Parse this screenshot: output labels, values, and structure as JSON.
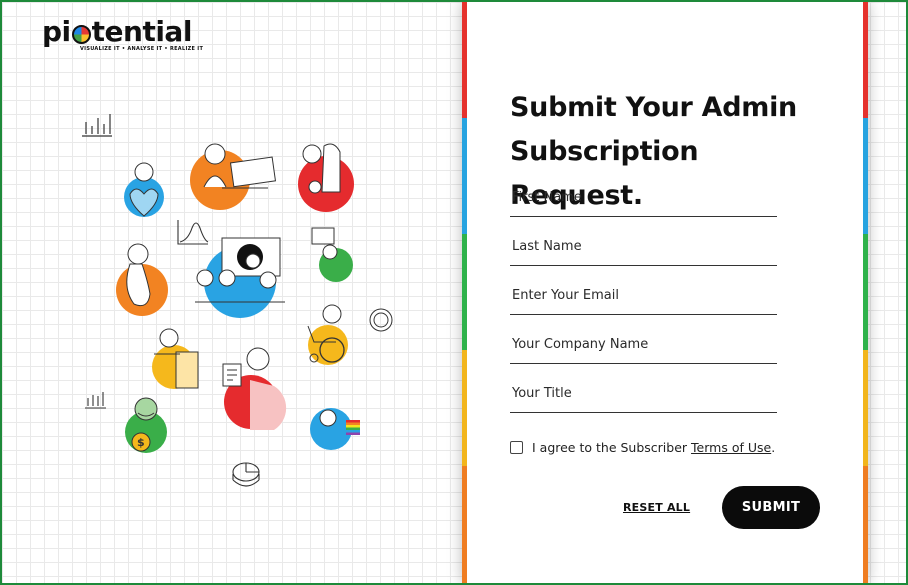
{
  "brand": {
    "name_left": "pi",
    "name_right": "tential",
    "tagline": "VISUALIZE IT • ANALYSE IT • REALIZE IT"
  },
  "form": {
    "title_line1": "Submit Your Admin",
    "title_line2": "Subscription Request.",
    "fields": [
      {
        "placeholder": "First Name",
        "value": ""
      },
      {
        "placeholder": "Last Name",
        "value": ""
      },
      {
        "placeholder": "Enter Your Email",
        "value": ""
      },
      {
        "placeholder": "Your Company Name",
        "value": ""
      },
      {
        "placeholder": "Your Title",
        "value": ""
      }
    ],
    "agree_text": "I agree to the Subscriber ",
    "terms_link": "Terms of Use",
    "agree_suffix": ".",
    "agree_checked": false,
    "reset_label": "RESET ALL",
    "submit_label": "SUBMIT"
  },
  "stripe_colors": [
    "#e5322d",
    "#27a3e0",
    "#2fb24b",
    "#f2b51c",
    "#ef7d22"
  ],
  "illustration": {
    "colors": {
      "orange": "#f28322",
      "blue": "#29a3e3",
      "red": "#e52b2e",
      "green": "#3aae49",
      "yellow": "#f5b81c"
    },
    "icons": [
      "bar-chart-icon",
      "bell-curve-icon",
      "donut-chart-icon",
      "pie-chart-icon",
      "mini-bar-chart-icon",
      "pride-flag-icon",
      "dollar-bag-icon",
      "wheelchair-icon",
      "laptop-icon"
    ]
  }
}
